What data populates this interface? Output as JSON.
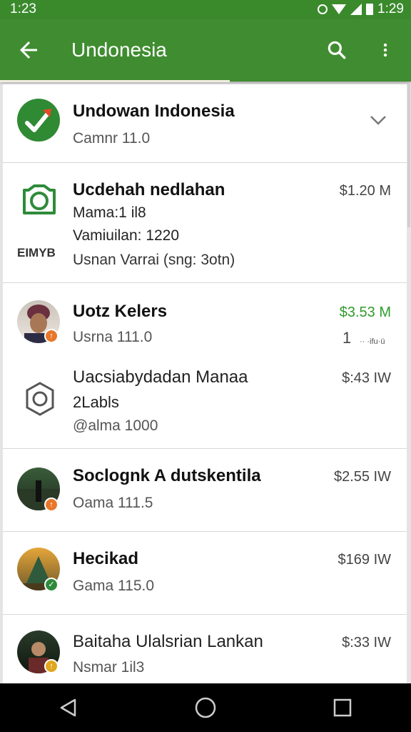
{
  "status_bar": {
    "time_left": "1:23",
    "time_right": "1:29"
  },
  "app_bar": {
    "title": "Undonesia"
  },
  "list": [
    {
      "name": "Undowan Indonesia",
      "sub": "Camnr 11.0",
      "icon": "check-arrow-icon"
    },
    {
      "name": "Ucdehah nedlahan",
      "lines": [
        "Mama:1 il8",
        "Vamiuilan: 1220",
        "Usnan Varrai (sng: 3otn)"
      ],
      "icon_label": "EIMYB",
      "price": "$1.20 M"
    },
    {
      "name": "Uotz Kelers",
      "sub": "Usrna 111.0",
      "price": "$3.53 M",
      "extra": "1",
      "extra_small": "·· ·ifu·ü"
    },
    {
      "name": "Uacsiabydadan Manaa",
      "name2": "2Labls",
      "sub": "@alma 1000",
      "price": "$:43 IW"
    },
    {
      "name": "Soclognk A dutskentila",
      "sub": "Oama 111.5",
      "price": "$2.55 IW"
    },
    {
      "name": "Hecikad",
      "sub": "Gama 115.0",
      "price": "$169 IW"
    },
    {
      "name": "Baitaha Ulalsrian Lankan",
      "sub": "Nsmar 1il3",
      "price": "$:33 IW"
    }
  ],
  "colors": {
    "app_bar": "#3f8d30",
    "status_bar": "#3a8a2c",
    "price_green": "#2f9b2b",
    "badge_orange": "#e8772a",
    "badge_green": "#2e8b3a",
    "badge_yellow": "#e0a61e"
  }
}
